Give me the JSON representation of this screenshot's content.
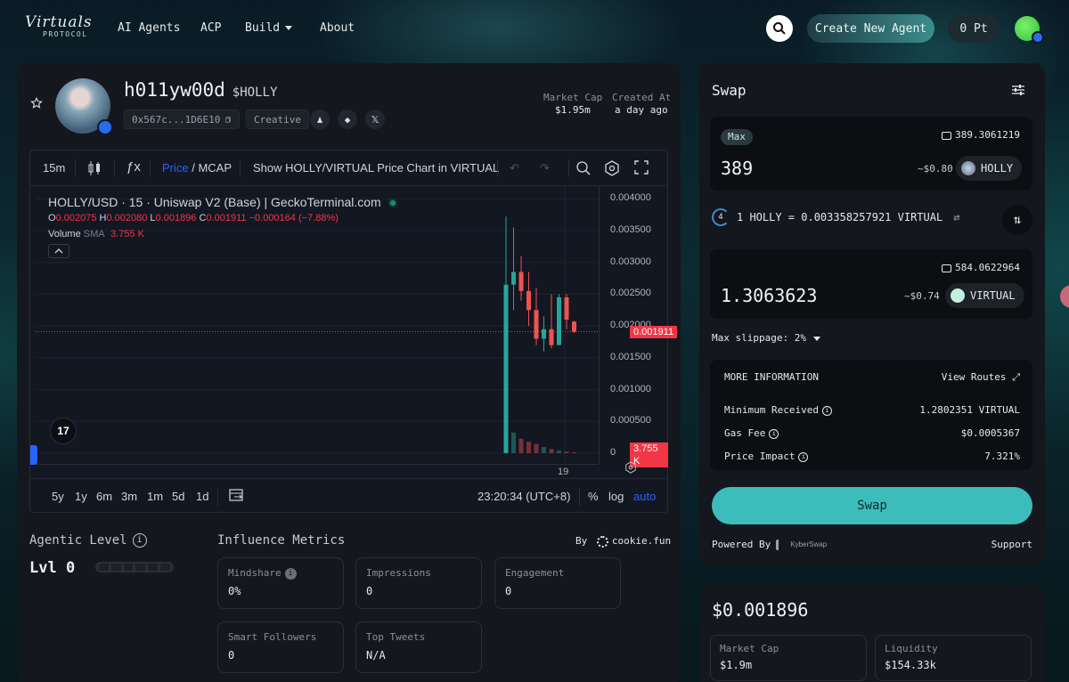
{
  "nav": {
    "logo_script": "Virtuals",
    "logo_sub": "PROTOCOL",
    "links": [
      "AI Agents",
      "ACP",
      "Build",
      "About"
    ],
    "create_label": "Create New Agent",
    "points_label": "0 Pt"
  },
  "token": {
    "name": "h011yw00d",
    "ticker": "$HOLLY",
    "address": "0x567c...1D6E10",
    "category": "Creative",
    "market_cap_label": "Market Cap",
    "market_cap_value": "$1.95m",
    "created_label": "Created At",
    "created_value": "a day ago"
  },
  "chart": {
    "interval": "15m",
    "price_label": "Price",
    "mcap_label": "MCAP",
    "show_in_label": "Show HOLLY/VIRTUAL Price Chart in VIRTUAL",
    "title": "HOLLY/USD · 15 · Uniswap V2 (Base) | GeckoTerminal.com",
    "ohlc": {
      "o_label": "O",
      "o": "0.002075",
      "h_label": "H",
      "h": "0.002080",
      "l_label": "L",
      "l": "0.001896",
      "c_label": "C",
      "c": "0.001911",
      "chg": "−0.000164 (−7.88%)"
    },
    "volume_label": "Volume",
    "sma_label": "SMA",
    "volume_value": "3.755 K",
    "price_axis": [
      "0.004000",
      "0.003500",
      "0.003000",
      "0.002500",
      "0.002000",
      "0.001500",
      "0.001000",
      "0.000500",
      "0"
    ],
    "last_price": "0.001911",
    "last_volume": "3.755 K",
    "time_tick": "19",
    "tv_logo": "17",
    "ranges": [
      "5y",
      "1y",
      "6m",
      "3m",
      "1m",
      "5d",
      "1d"
    ],
    "clock": "23:20:34 (UTC+8)",
    "pct_label": "%",
    "log_label": "log",
    "auto_label": "auto"
  },
  "chart_data": {
    "type": "candlestick",
    "title": "HOLLY/USD · 15 · Uniswap V2 (Base) | GeckoTerminal.com",
    "ylim": [
      0,
      0.0042
    ],
    "candles": [
      {
        "o": 0.0,
        "h": 0.00372,
        "l": 0.0,
        "c": 0.00265,
        "up": true
      },
      {
        "o": 0.00265,
        "h": 0.00355,
        "l": 0.00225,
        "c": 0.00285,
        "up": true
      },
      {
        "o": 0.00285,
        "h": 0.0031,
        "l": 0.0024,
        "c": 0.00255,
        "up": false
      },
      {
        "o": 0.00255,
        "h": 0.00285,
        "l": 0.002,
        "c": 0.00225,
        "up": false
      },
      {
        "o": 0.00225,
        "h": 0.0026,
        "l": 0.0017,
        "c": 0.0018,
        "up": false
      },
      {
        "o": 0.0018,
        "h": 0.00215,
        "l": 0.0016,
        "c": 0.00195,
        "up": true
      },
      {
        "o": 0.00195,
        "h": 0.0025,
        "l": 0.00165,
        "c": 0.0017,
        "up": false
      },
      {
        "o": 0.0017,
        "h": 0.0025,
        "l": 0.0017,
        "c": 0.00245,
        "up": true
      },
      {
        "o": 0.00245,
        "h": 0.0025,
        "l": 0.00195,
        "c": 0.0021,
        "up": false
      },
      {
        "o": 0.00207,
        "h": 0.00208,
        "l": 0.00189,
        "c": 0.00191,
        "up": false
      }
    ],
    "volume": [
      1.0,
      0.4,
      0.28,
      0.22,
      0.18,
      0.12,
      0.08,
      0.05,
      0.03,
      0.02
    ]
  },
  "lower": {
    "agentic_label": "Agentic Level",
    "level": "Lvl 0",
    "influence_label": "Influence Metrics",
    "by_label": "By",
    "by_source": "cookie.fun",
    "metrics": [
      {
        "label": "Mindshare",
        "value": "0%"
      },
      {
        "label": "Impressions",
        "value": "0"
      },
      {
        "label": "Engagement",
        "value": "0"
      },
      {
        "label": "Smart Followers",
        "value": "0"
      },
      {
        "label": "Top Tweets",
        "value": "N/A"
      }
    ]
  },
  "swap": {
    "title": "Swap",
    "max_label": "Max",
    "from_balance": "389.3061219",
    "from_amount": "389",
    "from_usd": "~$0.80",
    "from_token": "HOLLY",
    "rate_countdown": "4",
    "rate": "1 HOLLY = 0.003358257921 VIRTUAL",
    "to_balance": "584.0622964",
    "to_amount": "1.3063623",
    "to_usd": "~$0.74",
    "to_token": "VIRTUAL",
    "slippage": "Max slippage: 2%",
    "more_info": "MORE INFORMATION",
    "view_routes": "View Routes",
    "min_received_label": "Minimum Received",
    "min_received_value": "1.2802351 VIRTUAL",
    "gas_label": "Gas Fee",
    "gas_value": "$0.0005367",
    "impact_label": "Price Impact",
    "impact_value": "7.321%",
    "swap_button": "Swap",
    "powered_by": "Powered By",
    "kyber": "KyberSwap",
    "support": "Support"
  },
  "price_panel": {
    "price": "$0.001896",
    "mcap_label": "Market Cap",
    "mcap_value": "$1.9m",
    "liq_label": "Liquidity",
    "liq_value": "$154.33k"
  },
  "colors": {
    "accent": "#3dbcbc",
    "up": "#26a69a",
    "down": "#ef5350",
    "link": "#2962ff"
  }
}
